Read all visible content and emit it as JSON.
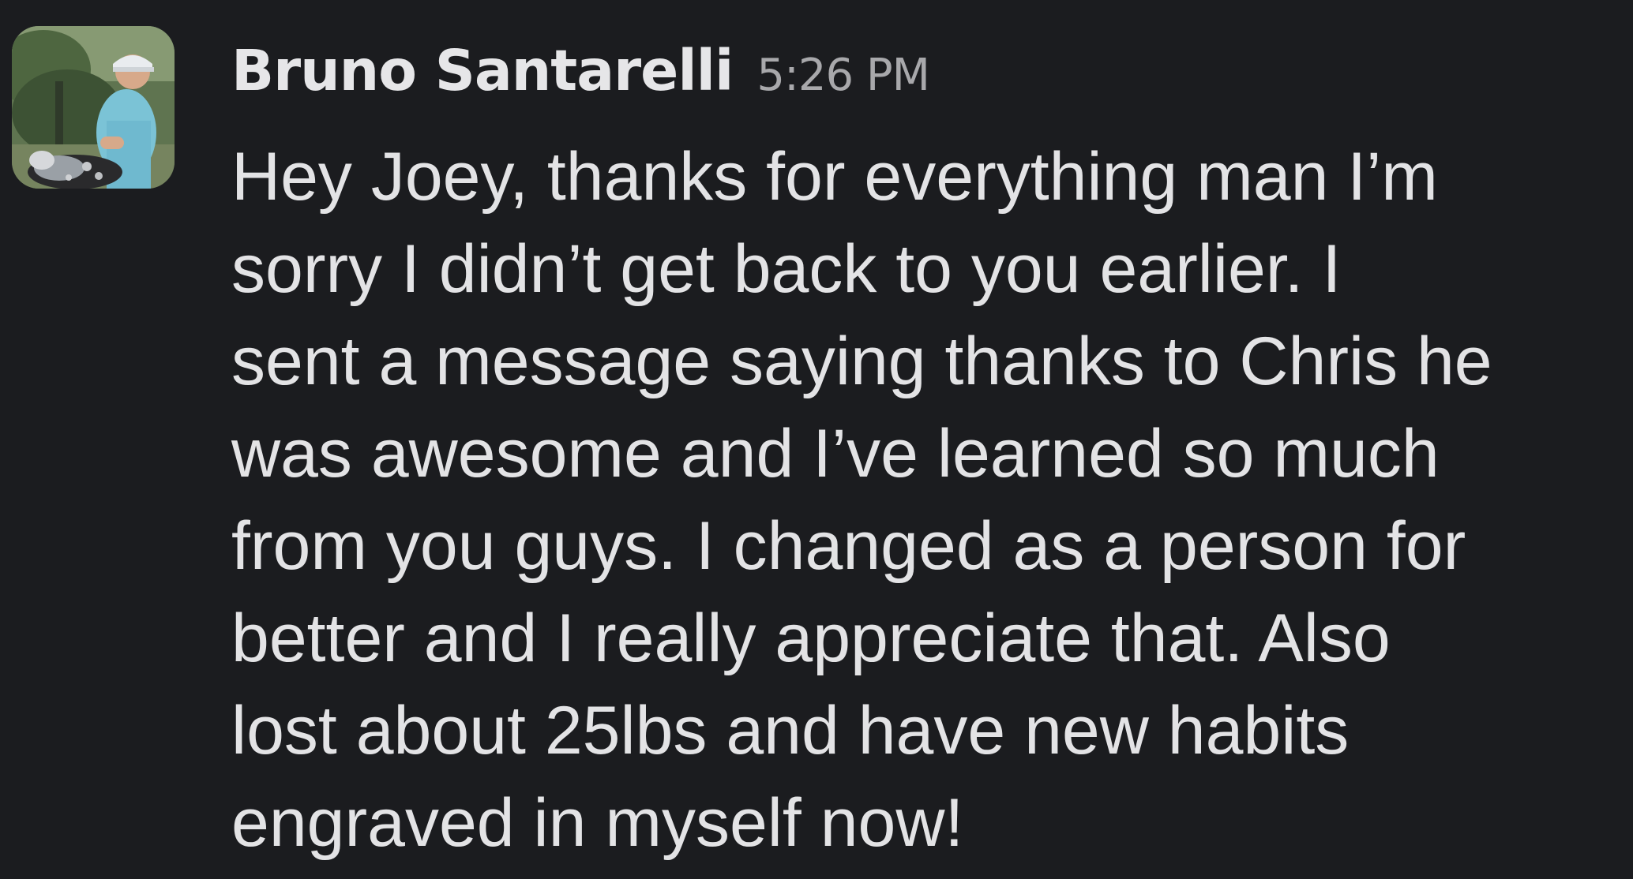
{
  "message": {
    "sender": "Bruno Santarelli",
    "timestamp": "5:26 PM",
    "lines": [
      "Hey Joey, thanks for everything man I’m",
      "sorry I didn’t get back to you earlier. I",
      "sent a message saying thanks to Chris he",
      "was awesome and I’ve learned so much",
      "from you guys. I changed as a person for",
      "better and I really appreciate that. Also",
      "lost about 25lbs and have new habits",
      "engraved in myself now!"
    ]
  },
  "colors": {
    "background": "#1b1c1f",
    "sender": "#e6e6e8",
    "timestamp": "#a8a8ab",
    "text": "#e3e3e5"
  }
}
